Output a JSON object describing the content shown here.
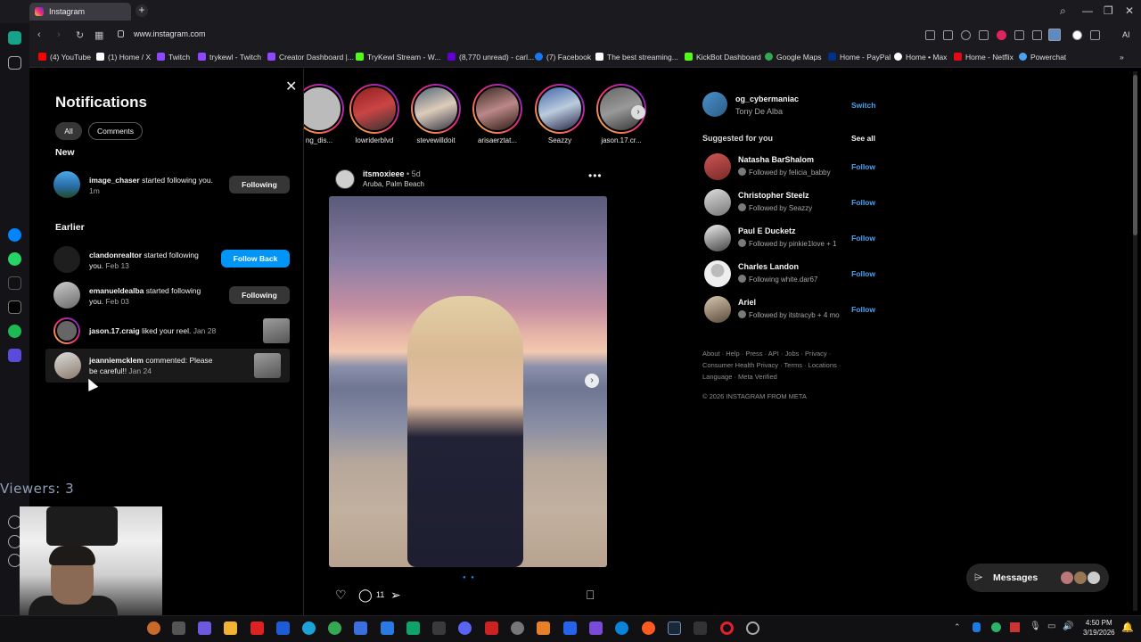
{
  "browser": {
    "tab_title": "Instagram",
    "url": "www.instagram.com",
    "new_tab": "+",
    "bookmarks": [
      {
        "label": "(4) YouTube",
        "color": "#ff0000"
      },
      {
        "label": "(1) Home / X",
        "color": "#ffffff"
      },
      {
        "label": "Twitch",
        "color": "#9146ff"
      },
      {
        "label": "trykewl - Twitch",
        "color": "#9146ff"
      },
      {
        "label": "Creator Dashboard |...",
        "color": "#9146ff"
      },
      {
        "label": "TryKewl Stream - W...",
        "color": "#53fc18"
      },
      {
        "label": "(8,770 unread) - carl...",
        "color": "#6001d2"
      },
      {
        "label": "(7) Facebook",
        "color": "#1877f2"
      },
      {
        "label": "The best streaming...",
        "color": "#ffffff"
      },
      {
        "label": "KickBot Dashboard",
        "color": "#53fc18"
      },
      {
        "label": "Google Maps",
        "color": "#34a853"
      },
      {
        "label": "Home - PayPal",
        "color": "#003087"
      },
      {
        "label": "Home • Max",
        "color": "#ffffff"
      },
      {
        "label": "Home - Netflix",
        "color": "#e50914"
      },
      {
        "label": "Powerchat",
        "color": "#4ca3f0"
      }
    ],
    "ai_label": "AI"
  },
  "notifications": {
    "title": "Notifications",
    "filters": [
      "All",
      "Comments"
    ],
    "new_label": "New",
    "earlier_label": "Earlier",
    "new_items": [
      {
        "user": "image_chaser",
        "text": " started following you.",
        "time": " 1m",
        "action": "Following"
      }
    ],
    "earlier_items": [
      {
        "user": "clandonrealtor",
        "text": " started following you.",
        "time": " Feb 13",
        "action": "Follow Back"
      },
      {
        "user": "emanueldealba",
        "text": " started following you.",
        "time": " Feb 03",
        "action": "Following"
      },
      {
        "user": "jason.17.craig",
        "text": " liked your reel.",
        "time": " Jan 28"
      },
      {
        "user": "jeanniemcklem",
        "text": " commented: Please be careful!!",
        "time": " Jan 24"
      }
    ]
  },
  "stories": [
    {
      "name": "ng_dis..."
    },
    {
      "name": "lowriderblvd"
    },
    {
      "name": "stevewilldoit"
    },
    {
      "name": "arisaerztat..."
    },
    {
      "name": "Seazzy"
    },
    {
      "name": "jason.17.cr..."
    }
  ],
  "post": {
    "user": "itsmoxieee",
    "time": " • 5d",
    "location": "Aruba, Palm Beach",
    "more": "•••",
    "comment_count": "11",
    "image_index": 1,
    "image_count": 2
  },
  "sidebar": {
    "username": "og_cybermaniac",
    "fullname": "Tony De Alba",
    "switch": "Switch",
    "suggested_title": "Suggested for you",
    "see_all": "See all",
    "suggestions": [
      {
        "name": "Natasha BarShalom",
        "sub": "Followed by felicia_babby",
        "action": "Follow"
      },
      {
        "name": "Christopher Steelz",
        "sub": "Followed by Seazzy",
        "action": "Follow"
      },
      {
        "name": "Paul E Ducketz",
        "sub": "Followed by pinkie1love + 1",
        "action": "Follow"
      },
      {
        "name": "Charles Landon",
        "sub": "Following white.dar67",
        "action": "Follow"
      },
      {
        "name": "Ariel",
        "sub": "Followed by itstracyb + 4 mo",
        "action": "Follow"
      }
    ],
    "footer": "About · Help · Press · API · Jobs · Privacy · Consumer Health Privacy · Terms · Locations · Language · Meta Verified",
    "copyright": "© 2026 INSTAGRAM FROM META"
  },
  "messages": {
    "label": "Messages"
  },
  "overlay": {
    "viewers": "Viewers: 3"
  },
  "taskbar": {
    "time": "4:50 PM",
    "date": "3/19/2026"
  }
}
